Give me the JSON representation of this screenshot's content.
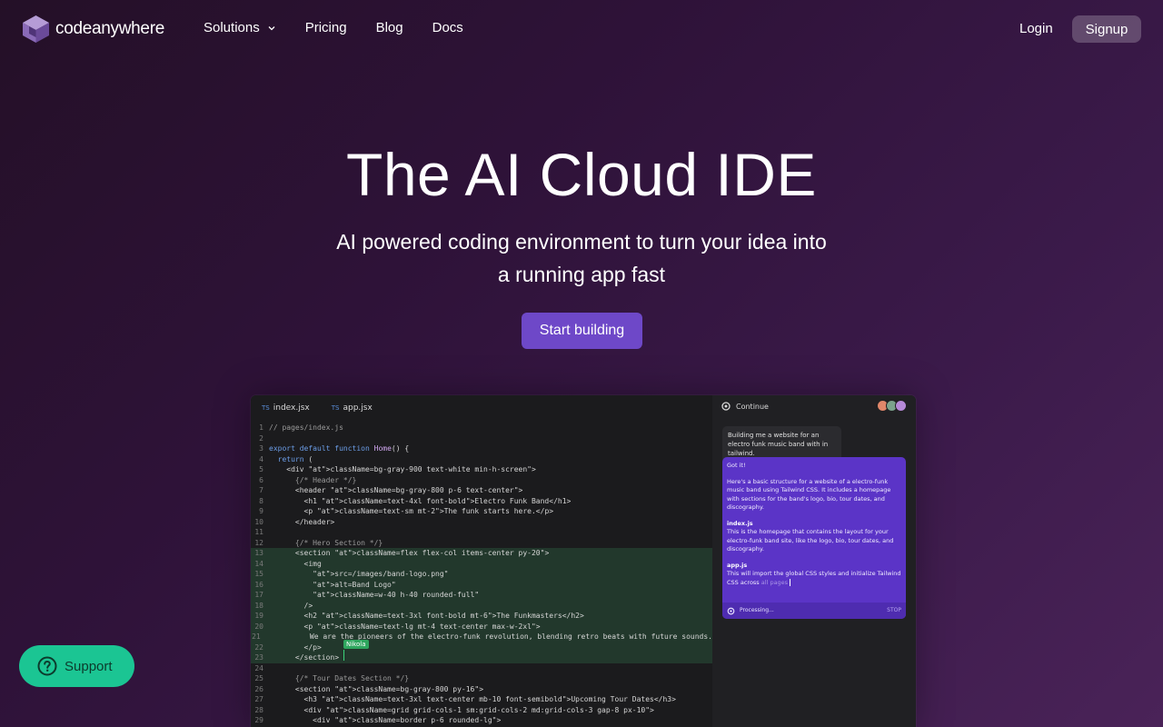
{
  "brand": {
    "name": "codeanywhere"
  },
  "nav": {
    "links": [
      {
        "label": "Solutions",
        "has_dropdown": true
      },
      {
        "label": "Pricing"
      },
      {
        "label": "Blog"
      },
      {
        "label": "Docs"
      }
    ],
    "login": "Login",
    "signup": "Signup"
  },
  "hero": {
    "title": "The AI Cloud IDE",
    "subtitle": "AI powered coding environment to turn your idea into a running app fast",
    "cta": "Start building"
  },
  "ide": {
    "tabs": [
      {
        "lang": "TS",
        "label": "index.jsx"
      },
      {
        "lang": "TS",
        "label": "app.jsx"
      }
    ],
    "cursor_user": "Nikola",
    "code_lines": [
      {
        "n": "1",
        "text": "// pages/index.js"
      },
      {
        "n": "2",
        "text": ""
      },
      {
        "n": "3",
        "text": "export default function Home() {"
      },
      {
        "n": "4",
        "text": "  return ("
      },
      {
        "n": "5",
        "text": "    <div className=\"bg-gray-900 text-white min-h-screen\">"
      },
      {
        "n": "6",
        "text": "      {/* Header */}"
      },
      {
        "n": "7",
        "text": "      <header className=\"bg-gray-800 p-6 text-center\">"
      },
      {
        "n": "8",
        "text": "        <h1 className=\"text-4xl font-bold\">Electro Funk Band</h1>"
      },
      {
        "n": "9",
        "text": "        <p className=\"text-sm mt-2\">The funk starts here.</p>"
      },
      {
        "n": "10",
        "text": "      </header>"
      },
      {
        "n": "11",
        "text": ""
      },
      {
        "n": "12",
        "text": "      {/* Hero Section */}"
      },
      {
        "n": "13",
        "text": "      <section className=\"flex flex-col items-center py-20\">"
      },
      {
        "n": "14",
        "text": "        <img"
      },
      {
        "n": "15",
        "text": "          src=\"/images/band-logo.png\""
      },
      {
        "n": "16",
        "text": "          alt=\"Band Logo\""
      },
      {
        "n": "17",
        "text": "          className=\"w-40 h-40 rounded-full\""
      },
      {
        "n": "18",
        "text": "        />"
      },
      {
        "n": "19",
        "text": "        <h2 className=\"text-3xl font-bold mt-6\">The Funkmasters</h2>"
      },
      {
        "n": "20",
        "text": "        <p className=\"text-lg mt-4 text-center max-w-2xl\">"
      },
      {
        "n": "21",
        "text": "          We are the pioneers of the electro-funk revolution, blending retro beats with future sounds."
      },
      {
        "n": "22",
        "text": "        </p>"
      },
      {
        "n": "23",
        "text": "      </section>"
      },
      {
        "n": "24",
        "text": ""
      },
      {
        "n": "25",
        "text": "      {/* Tour Dates Section */}"
      },
      {
        "n": "26",
        "text": "      <section className=\"bg-gray-800 py-16\">"
      },
      {
        "n": "27",
        "text": "        <h3 className=\"text-3xl text-center mb-10 font-semibold\">Upcoming Tour Dates</h3>"
      },
      {
        "n": "28",
        "text": "        <div className=\"grid grid-cols-1 sm:grid-cols-2 md:grid-cols-3 gap-8 px-10\">"
      },
      {
        "n": "29",
        "text": "          <div className=\"border p-6 rounded-lg\">"
      }
    ],
    "chat": {
      "header": "Continue",
      "user_message": "Building me a website for an electro funk music band with in tailwind.",
      "ai_intro": "Got it!",
      "ai_text": "Here's a basic structure for a website of a electro-funk music band using Tailwind CSS. It includes a homepage with sections for the band's logo, bio, tour dates, and discography.",
      "files": [
        {
          "name": "index.js",
          "desc": "This is the homepage that contains the layout for your electro-funk band site, like the logo, bio, tour dates, and discography."
        },
        {
          "name": "app.js",
          "desc": "This will import the global CSS styles and initialize Tailwind CSS across",
          "faded": "all pages"
        }
      ],
      "status": "Processing...",
      "stop": "STOP"
    }
  },
  "support": {
    "label": "Support"
  },
  "colors": {
    "accent": "#6e48c8",
    "support": "#1bc593",
    "ai_bubble": "#5b34c7",
    "highlight": "#22382c"
  }
}
